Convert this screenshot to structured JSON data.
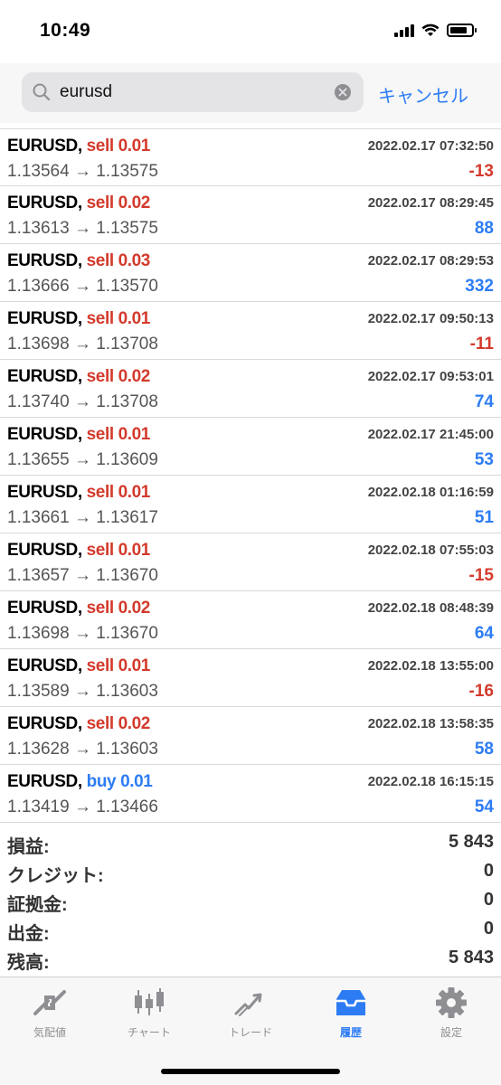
{
  "status_bar": {
    "time": "10:49"
  },
  "search": {
    "query": "eurusd",
    "cancel_label": "キャンセル"
  },
  "deals": [
    {
      "symbol": "EURUSD,",
      "side": "sell 0.01",
      "side_color": "red",
      "time": "2022.02.17 07:32:50",
      "prices": "1.13564 → 1.13575",
      "profit": "-13",
      "profit_color": "red"
    },
    {
      "symbol": "EURUSD,",
      "side": "sell 0.02",
      "side_color": "red",
      "time": "2022.02.17 08:29:45",
      "prices": "1.13613 → 1.13575",
      "profit": "88",
      "profit_color": "blue"
    },
    {
      "symbol": "EURUSD,",
      "side": "sell 0.03",
      "side_color": "red",
      "time": "2022.02.17 08:29:53",
      "prices": "1.13666 → 1.13570",
      "profit": "332",
      "profit_color": "blue"
    },
    {
      "symbol": "EURUSD,",
      "side": "sell 0.01",
      "side_color": "red",
      "time": "2022.02.17 09:50:13",
      "prices": "1.13698 → 1.13708",
      "profit": "-11",
      "profit_color": "red"
    },
    {
      "symbol": "EURUSD,",
      "side": "sell 0.02",
      "side_color": "red",
      "time": "2022.02.17 09:53:01",
      "prices": "1.13740 → 1.13708",
      "profit": "74",
      "profit_color": "blue"
    },
    {
      "symbol": "EURUSD,",
      "side": "sell 0.01",
      "side_color": "red",
      "time": "2022.02.17 21:45:00",
      "prices": "1.13655 → 1.13609",
      "profit": "53",
      "profit_color": "blue"
    },
    {
      "symbol": "EURUSD,",
      "side": "sell 0.01",
      "side_color": "red",
      "time": "2022.02.18 01:16:59",
      "prices": "1.13661 → 1.13617",
      "profit": "51",
      "profit_color": "blue"
    },
    {
      "symbol": "EURUSD,",
      "side": "sell 0.01",
      "side_color": "red",
      "time": "2022.02.18 07:55:03",
      "prices": "1.13657 → 1.13670",
      "profit": "-15",
      "profit_color": "red"
    },
    {
      "symbol": "EURUSD,",
      "side": "sell 0.02",
      "side_color": "red",
      "time": "2022.02.18 08:48:39",
      "prices": "1.13698 → 1.13670",
      "profit": "64",
      "profit_color": "blue"
    },
    {
      "symbol": "EURUSD,",
      "side": "sell 0.01",
      "side_color": "red",
      "time": "2022.02.18 13:55:00",
      "prices": "1.13589 → 1.13603",
      "profit": "-16",
      "profit_color": "red"
    },
    {
      "symbol": "EURUSD,",
      "side": "sell 0.02",
      "side_color": "red",
      "time": "2022.02.18 13:58:35",
      "prices": "1.13628 → 1.13603",
      "profit": "58",
      "profit_color": "blue"
    },
    {
      "symbol": "EURUSD,",
      "side": "buy 0.01",
      "side_color": "blue",
      "time": "2022.02.18 16:15:15",
      "prices": "1.13419 → 1.13466",
      "profit": "54",
      "profit_color": "blue"
    }
  ],
  "summary": [
    {
      "label": "損益:",
      "value": "5 843"
    },
    {
      "label": "クレジット:",
      "value": "0"
    },
    {
      "label": "証拠金:",
      "value": "0"
    },
    {
      "label": "出金:",
      "value": "0"
    },
    {
      "label": "残高:",
      "value": "5 843"
    }
  ],
  "tabs": [
    {
      "label": "気配値",
      "icon": "quotes-icon",
      "active": false
    },
    {
      "label": "チャート",
      "icon": "chart-icon",
      "active": false
    },
    {
      "label": "トレード",
      "icon": "trade-icon",
      "active": false
    },
    {
      "label": "履歴",
      "icon": "history-icon",
      "active": true
    },
    {
      "label": "設定",
      "icon": "settings-icon",
      "active": false
    }
  ],
  "colors": {
    "accent": "#2d7cf4",
    "loss": "#d33a2c",
    "profit": "#2d7cf4"
  }
}
